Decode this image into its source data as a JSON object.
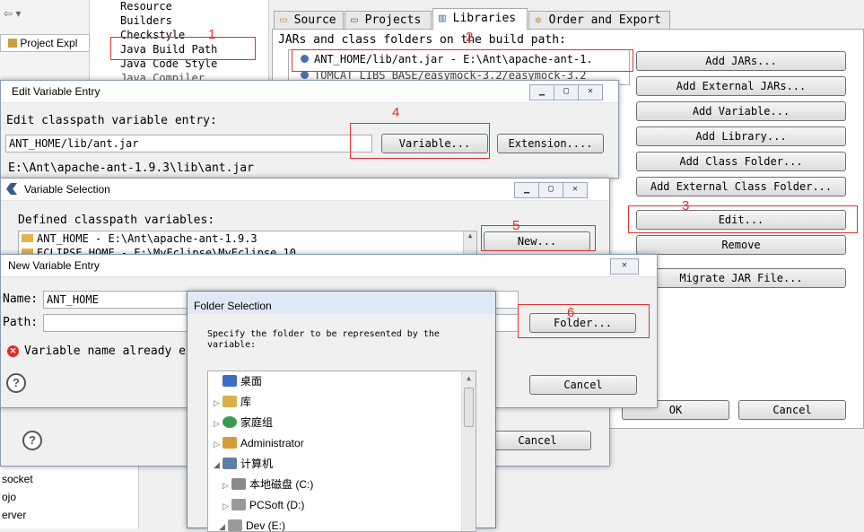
{
  "left_nav": {
    "items": [
      "Resource",
      "Builders",
      "Checkstyle",
      "Java Build Path",
      "Java Code Style",
      "Java Compiler"
    ],
    "project_explorer": "Project Expl",
    "bottom_items": [
      "socket",
      "ojo",
      "erver"
    ]
  },
  "tabs": [
    {
      "label": "Source"
    },
    {
      "label": "Projects"
    },
    {
      "label": "Libraries"
    },
    {
      "label": "Order and Export"
    }
  ],
  "libraries": {
    "header": "JARs and class folders on the build path:",
    "entries": [
      "ANT_HOME/lib/ant.jar - E:\\Ant\\apache-ant-1.",
      "TOMCAT_LIBS_BASE/easymock-3.2/easymock-3.2"
    ],
    "buttons": [
      "Add JARs...",
      "Add External JARs...",
      "Add Variable...",
      "Add Library...",
      "Add Class Folder...",
      "Add External Class Folder...",
      "Edit...",
      "Remove",
      "Migrate JAR File..."
    ],
    "ok": "OK",
    "cancel": "Cancel"
  },
  "edit_variable": {
    "title": "Edit Variable Entry",
    "label": "Edit classpath variable entry:",
    "value": "ANT_HOME/lib/ant.jar",
    "variable_btn": "Variable...",
    "extension_btn": "Extension....",
    "resolved": "E:\\Ant\\apache-ant-1.9.3\\lib\\ant.jar"
  },
  "variable_selection": {
    "title": "Variable Selection",
    "label": "Defined classpath variables:",
    "rows": [
      "ANT_HOME - E:\\Ant\\apache-ant-1.9.3",
      "ECLIPSE_HOME - E:\\MyEclipse\\MyEclipse 10"
    ],
    "new_btn": "New...",
    "cancel": "Cancel"
  },
  "new_variable": {
    "title": "New Variable Entry",
    "name_label": "Name:",
    "name_value": "ANT_HOME",
    "path_label": "Path:",
    "path_value": "",
    "error": "Variable name already e",
    "folder_btn": "Folder...",
    "cancel": "Cancel"
  },
  "folder_selection": {
    "title": "Folder Selection",
    "desc": "Specify the folder to be represented by the variable:",
    "tree": [
      {
        "label": "桌面",
        "icon": "desktop-icon",
        "color": "#3a6fc4",
        "arrow": ""
      },
      {
        "label": "库",
        "icon": "library-icon",
        "color": "#d9b04a",
        "arrow": "▷"
      },
      {
        "label": "家庭组",
        "icon": "homegroup-icon",
        "color": "#3a9a4a",
        "arrow": "▷"
      },
      {
        "label": "Administrator",
        "icon": "user-icon",
        "color": "#d89b3c",
        "arrow": "▷"
      },
      {
        "label": "计算机",
        "icon": "computer-icon",
        "color": "#5b7fa8",
        "arrow": "◢"
      },
      {
        "label": "本地磁盘 (C:)",
        "icon": "drive-c-icon",
        "color": "#8a8a8a",
        "arrow": "▷"
      },
      {
        "label": "PCSoft (D:)",
        "icon": "drive-icon",
        "color": "#9a9a9a",
        "arrow": "▷"
      },
      {
        "label": "Dev (E:)",
        "icon": "drive-icon",
        "color": "#9a9a9a",
        "arrow": "◢"
      }
    ]
  },
  "annotations": [
    "1",
    "2",
    "3",
    "4",
    "5",
    "6"
  ],
  "colors": {
    "annotation": "#e03030",
    "selection": "#cfe3f7"
  }
}
